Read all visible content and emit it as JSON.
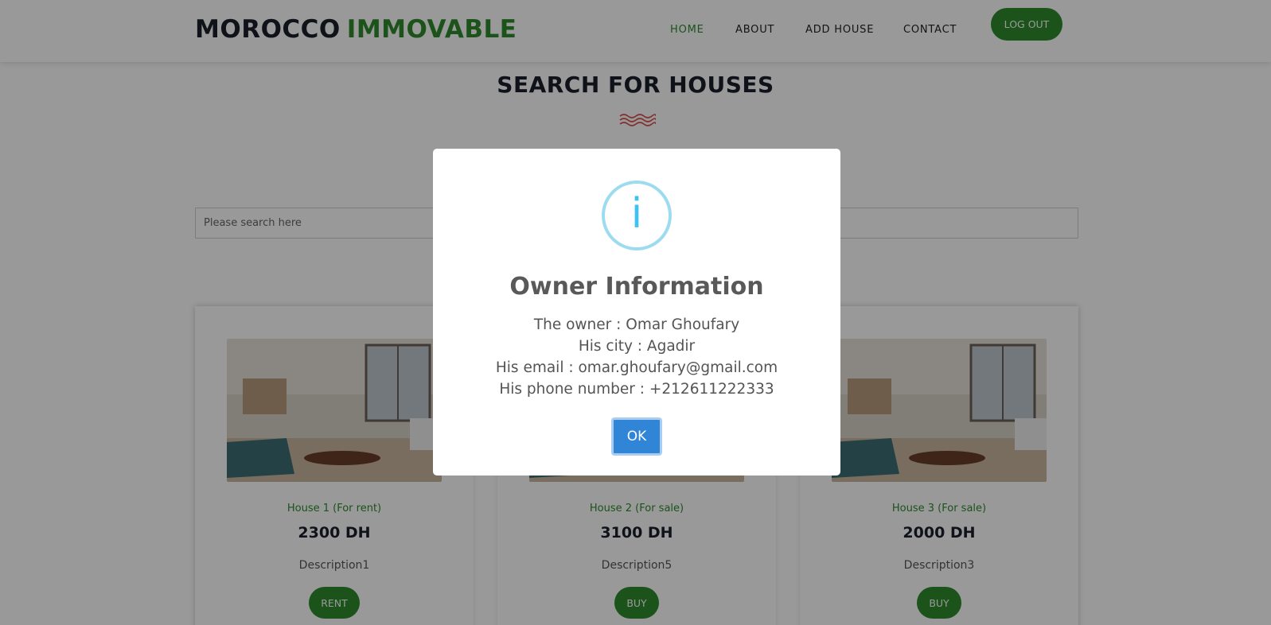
{
  "header": {
    "logo_part1": "MOROCCO",
    "logo_part2": "IMMOVABLE",
    "nav": [
      "HOME",
      "ABOUT",
      "ADD HOUSE",
      "CONTACT"
    ],
    "logout_label": "LOG OUT"
  },
  "search": {
    "title": "SEARCH FOR HOUSES",
    "placeholder": "Please search here"
  },
  "cards": [
    {
      "title": "House 1 (For rent)",
      "price": "2300 DH",
      "description": "Description1",
      "button": "RENT"
    },
    {
      "title": "House 2 (For sale)",
      "price": "3100 DH",
      "description": "Description5",
      "button": "BUY"
    },
    {
      "title": "House 3 (For sale)",
      "price": "2000 DH",
      "description": "Description3",
      "button": "BUY"
    }
  ],
  "modal": {
    "icon": "info-icon",
    "icon_glyph": "i",
    "title": "Owner Information",
    "owner": "The owner : Omar Ghoufary",
    "city": "His city : Agadir",
    "email": "His email : omar.ghoufary@gmail.com",
    "phone": "His phone number : +212611222333",
    "ok_label": "OK"
  },
  "colors": {
    "brand_green": "#2e8b2e",
    "dark_text": "#1a1f2b",
    "ok_blue": "#3085d6",
    "info_ring": "#9ddcf0",
    "wave_red": "#d9534f"
  }
}
